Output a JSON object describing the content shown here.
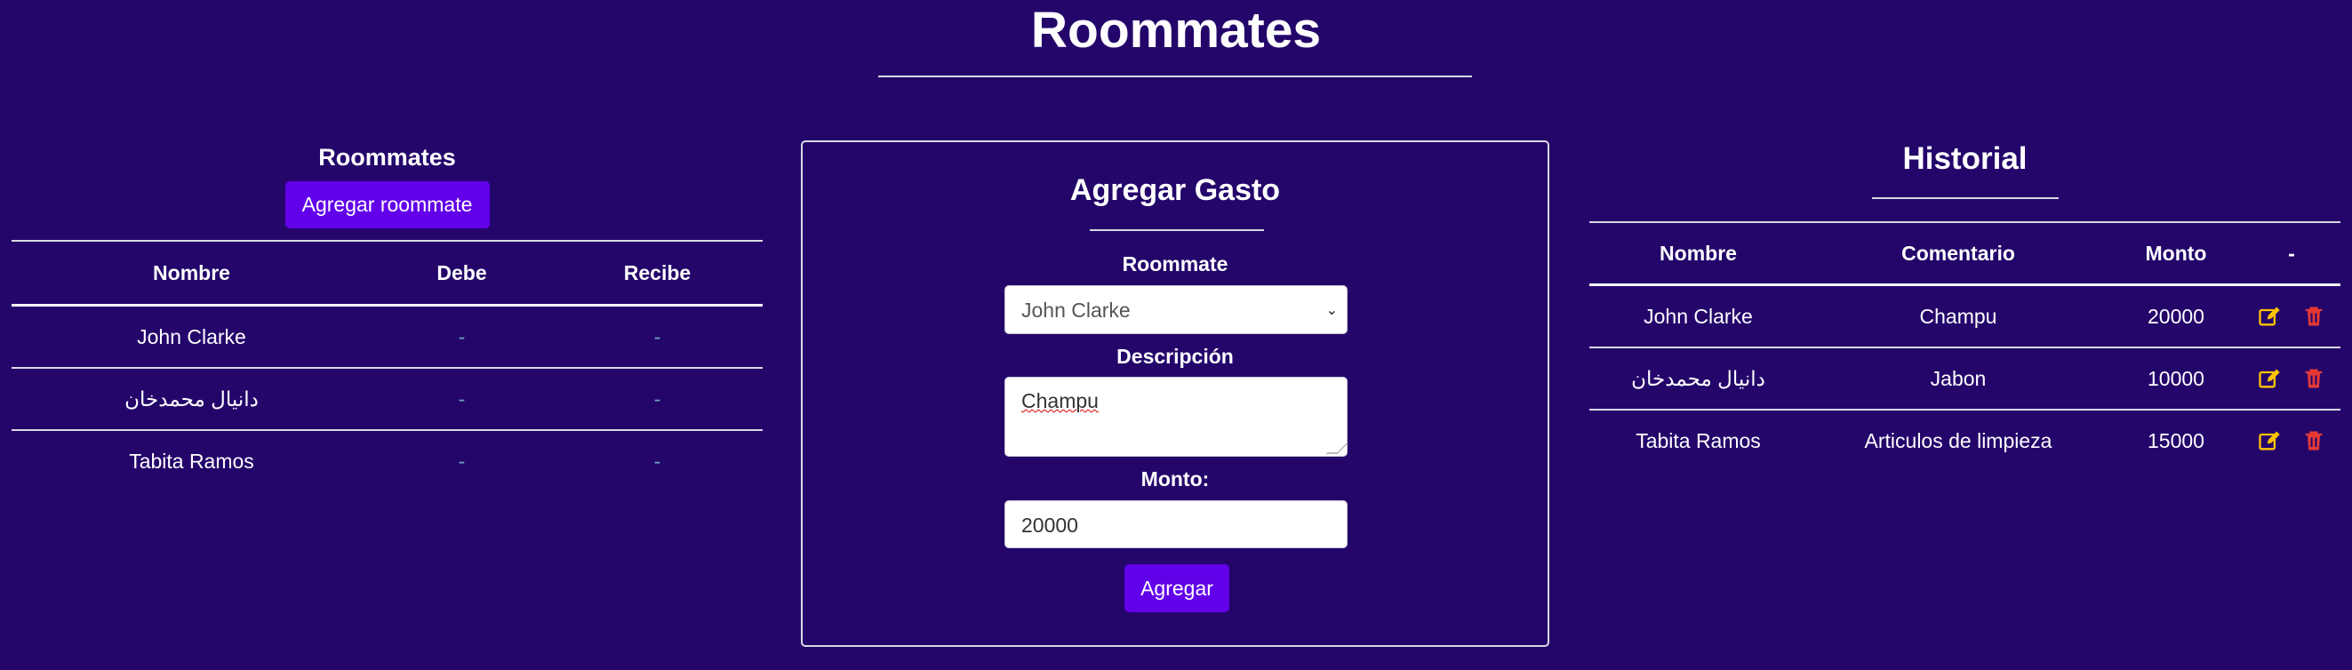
{
  "page": {
    "title": "Roommates"
  },
  "roommates_panel": {
    "heading": "Roommates",
    "add_button_label": "Agregar roommate",
    "columns": [
      "Nombre",
      "Debe",
      "Recibe"
    ],
    "rows": [
      {
        "nombre": "John Clarke",
        "debe": "-",
        "recibe": "-"
      },
      {
        "nombre": "دانیال محمدخان",
        "debe": "-",
        "recibe": "-"
      },
      {
        "nombre": "Tabita Ramos",
        "debe": "-",
        "recibe": "-"
      }
    ]
  },
  "expense_form": {
    "title": "Agregar Gasto",
    "roommate_label": "Roommate",
    "roommate_selected": "John Clarke",
    "description_label": "Descripción",
    "description_value": "Champu",
    "amount_label": "Monto:",
    "amount_value": "20000",
    "submit_label": "Agregar"
  },
  "history_panel": {
    "title": "Historial",
    "columns": [
      "Nombre",
      "Comentario",
      "Monto",
      "-"
    ],
    "rows": [
      {
        "nombre": "John Clarke",
        "comentario": "Champu",
        "monto": "20000"
      },
      {
        "nombre": "دانیال محمدخان",
        "comentario": "Jabon",
        "monto": "10000"
      },
      {
        "nombre": "Tabita Ramos",
        "comentario": "Articulos de limpieza",
        "monto": "15000"
      }
    ],
    "action_icons": [
      "edit-icon",
      "delete-icon"
    ]
  },
  "colors": {
    "background": "#24066b",
    "accent": "#6200ea",
    "edit": "#ffc400",
    "delete": "#e53935",
    "muted_dash": "#6ba3c0"
  }
}
